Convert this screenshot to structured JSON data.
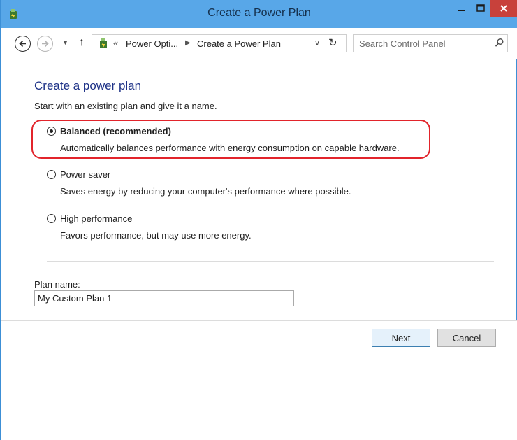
{
  "window": {
    "title": "Create a Power Plan",
    "accent_color": "#58a7e8",
    "close_color": "#c8413b"
  },
  "navigation": {
    "breadcrumb_parent": "Power Opti...",
    "breadcrumb_current": "Create a Power Plan",
    "search_placeholder": "Search Control Panel"
  },
  "main": {
    "heading": "Create a power plan",
    "intro": "Start with an existing plan and give it a name.",
    "options": [
      {
        "label": "Balanced (recommended)",
        "description": "Automatically balances performance with energy consumption on capable hardware.",
        "selected": true,
        "highlighted": true
      },
      {
        "label": "Power saver",
        "description": "Saves energy by reducing your computer's performance where possible.",
        "selected": false
      },
      {
        "label": "High performance",
        "description": "Favors performance, but may use more energy.",
        "selected": false
      }
    ],
    "plan_name_label": "Plan name:",
    "plan_name_value": "My Custom Plan 1"
  },
  "buttons": {
    "next": "Next",
    "cancel": "Cancel"
  },
  "icons": [
    "power-options-icon",
    "back-arrow-icon",
    "forward-arrow-icon",
    "recent-pages-chevron-icon",
    "up-arrow-icon",
    "refresh-icon",
    "search-icon",
    "minimize-icon",
    "maximize-icon",
    "close-icon"
  ]
}
